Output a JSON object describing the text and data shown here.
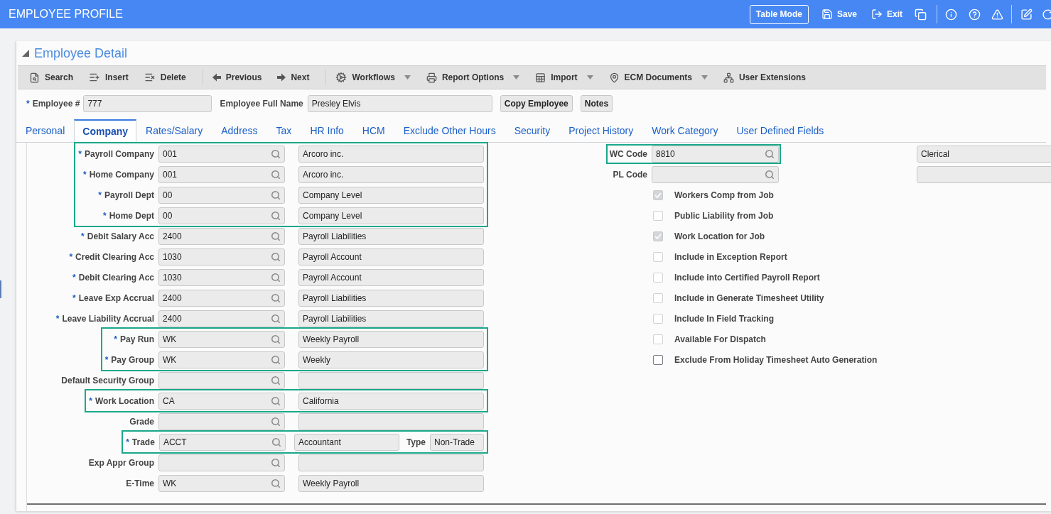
{
  "header": {
    "title": "EMPLOYEE PROFILE",
    "table_mode": "Table Mode",
    "save": "Save",
    "exit": "Exit"
  },
  "panel": {
    "title": "Employee Detail",
    "expanded": true
  },
  "toolbar": {
    "groups": [
      {
        "items": [
          {
            "label": "Search",
            "dropdown": false
          },
          {
            "label": "Insert",
            "dropdown": false
          },
          {
            "label": "Delete",
            "dropdown": false
          }
        ]
      },
      {
        "items": [
          {
            "label": "Previous",
            "dropdown": false
          },
          {
            "label": "Next",
            "dropdown": false
          }
        ]
      },
      {
        "items": [
          {
            "label": "Workflows",
            "dropdown": true
          },
          {
            "label": "Report Options",
            "dropdown": true
          },
          {
            "label": "Import",
            "dropdown": true
          },
          {
            "label": "ECM Documents",
            "dropdown": true
          },
          {
            "label": "User Extensions",
            "dropdown": false
          }
        ]
      }
    ]
  },
  "employee": {
    "number_marker": "*",
    "number_label": "Employee #",
    "number": "777",
    "name_label": "Employee Full Name",
    "name": "Presley Elvis",
    "buttons": [
      "Copy Employee",
      "Notes"
    ]
  },
  "tabs": [
    {
      "label": "Personal",
      "selected": false
    },
    {
      "label": "Company",
      "selected": true
    },
    {
      "label": "Rates/Salary",
      "selected": false
    },
    {
      "label": "Address",
      "selected": false
    },
    {
      "label": "Tax",
      "selected": false
    },
    {
      "label": "HR Info",
      "selected": false
    },
    {
      "label": "HCM",
      "selected": false
    },
    {
      "label": "Exclude Other Hours",
      "selected": false
    },
    {
      "label": "Security",
      "selected": false
    },
    {
      "label": "Project History",
      "selected": false
    },
    {
      "label": "Work Category",
      "selected": false
    },
    {
      "label": "User Defined Fields",
      "selected": false
    }
  ],
  "company": {
    "left_groups": [
      {
        "highlighted": true,
        "rows": [
          {
            "kind": "lookup",
            "marker": "*",
            "label": "Payroll Company",
            "code": "001",
            "description": "Arcoro inc."
          },
          {
            "kind": "lookup",
            "marker": "*",
            "label": "Home Company",
            "code": "001",
            "description": "Arcoro inc."
          },
          {
            "kind": "lookup",
            "marker": "*",
            "label": "Payroll Dept",
            "code": "00",
            "description": "Company Level"
          },
          {
            "kind": "lookup",
            "marker": "*",
            "label": "Home Dept",
            "code": "00",
            "description": "Company Level"
          }
        ]
      },
      {
        "highlighted": false,
        "rows": [
          {
            "kind": "lookup",
            "marker": "*",
            "label": "Debit Salary Acc",
            "code": "2400",
            "description": "Payroll Liabilities"
          },
          {
            "kind": "lookup",
            "marker": "*",
            "label": "Credit Clearing Acc",
            "code": "1030",
            "description": "Payroll Account"
          },
          {
            "kind": "lookup",
            "marker": "*",
            "label": "Debit Clearing Acc",
            "code": "1030",
            "description": "Payroll Account"
          },
          {
            "kind": "lookup",
            "marker": "*",
            "label": "Leave Exp Accrual",
            "code": "2400",
            "description": "Payroll Liabilities"
          },
          {
            "kind": "lookup",
            "marker": "*",
            "label": "Leave Liability Accrual",
            "code": "2400",
            "description": "Payroll Liabilities"
          }
        ]
      },
      {
        "highlighted": true,
        "rows": [
          {
            "kind": "lookup",
            "marker": "*",
            "label": "Pay Run",
            "code": "WK",
            "description": "Weekly Payroll"
          },
          {
            "kind": "lookup",
            "marker": "*",
            "label": "Pay Group",
            "code": "WK",
            "description": "Weekly"
          }
        ]
      },
      {
        "highlighted": false,
        "rows": [
          {
            "kind": "lookup",
            "label": "Default Security Group"
          }
        ]
      },
      {
        "highlighted": true,
        "rows": [
          {
            "kind": "lookup",
            "marker": "*",
            "label": "Work Location",
            "code": "CA",
            "description": "California"
          }
        ]
      },
      {
        "highlighted": false,
        "rows": [
          {
            "kind": "lookup",
            "label": "Grade"
          }
        ]
      },
      {
        "highlighted": true,
        "rows": [
          {
            "kind": "trade",
            "marker": "*",
            "label": "Trade",
            "code": "ACCT",
            "description": "Accountant",
            "type_label": "Type",
            "type_value": "Non-Trade"
          }
        ]
      },
      {
        "highlighted": false,
        "rows": [
          {
            "kind": "lookup",
            "label": "Exp Appr Group"
          },
          {
            "kind": "lookup",
            "label": "E-Time",
            "code": "WK",
            "description": "Weekly Payroll"
          }
        ]
      }
    ],
    "right_rows": [
      {
        "highlighted": true,
        "label": "WC Code",
        "code": "8810",
        "description": "Clerical"
      },
      {
        "highlighted": false,
        "label": "PL Code"
      }
    ],
    "checkboxes": [
      {
        "label": "Workers Comp from Job",
        "checked": true,
        "disabled": true
      },
      {
        "label": "Public Liability from Job",
        "checked": false,
        "disabled": true
      },
      {
        "label": "Work Location for Job",
        "checked": true,
        "disabled": true
      },
      {
        "label": "Include in Exception Report",
        "checked": false,
        "disabled": true
      },
      {
        "label": "Include into Certified Payroll Report",
        "checked": false,
        "disabled": true
      },
      {
        "label": "Include in Generate Timesheet Utility",
        "checked": false,
        "disabled": true
      },
      {
        "label": "Include In Field Tracking",
        "checked": false,
        "disabled": true
      },
      {
        "label": "Available For Dispatch",
        "checked": false,
        "disabled": true
      },
      {
        "label": "Exclude From Holiday Timesheet Auto Generation",
        "checked": false,
        "disabled": false
      }
    ]
  }
}
